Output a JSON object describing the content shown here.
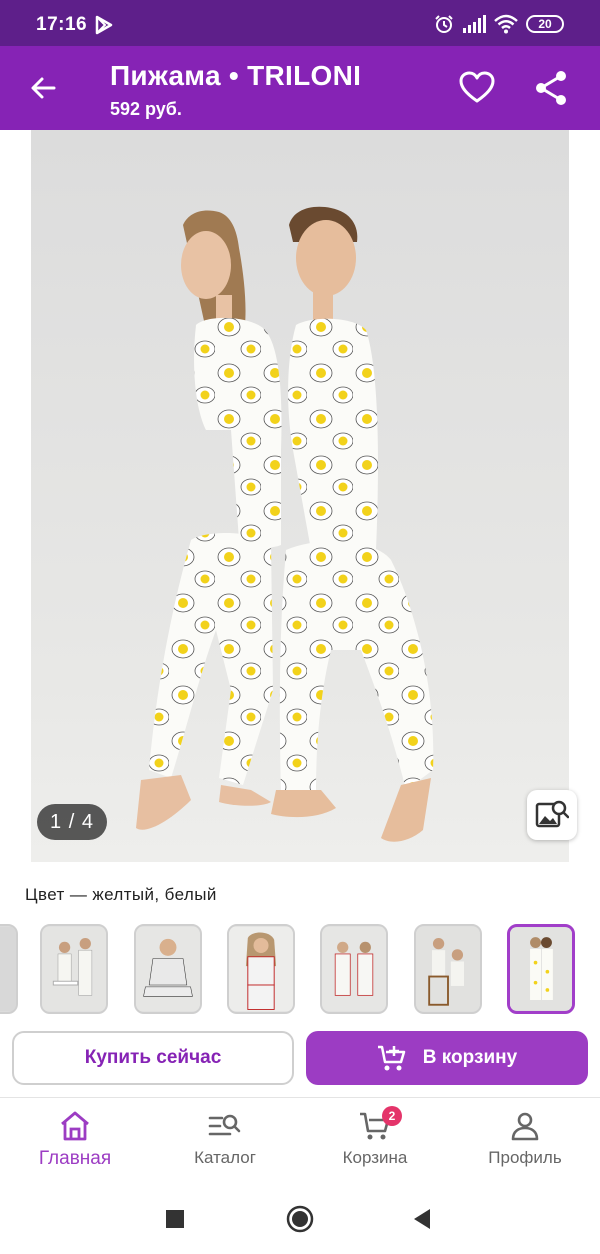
{
  "status_bar": {
    "time": "17:16",
    "battery": "20"
  },
  "header": {
    "title": "Пижама • TRILONI",
    "price": "592 руб."
  },
  "gallery": {
    "counter": "1 / 4"
  },
  "product": {
    "color_text": "Цвет — желтый, белый"
  },
  "actions": {
    "buy_now": "Купить сейчас",
    "add_to_cart": "В корзину"
  },
  "bottom_nav": {
    "items": [
      {
        "label": "Главная",
        "icon": "home-icon",
        "active": true
      },
      {
        "label": "Каталог",
        "icon": "catalog-search-icon"
      },
      {
        "label": "Корзина",
        "icon": "cart-icon",
        "badge": "2"
      },
      {
        "label": "Профиль",
        "icon": "profile-icon"
      }
    ]
  },
  "colors": {
    "status_bar": "#5e1f8a",
    "app_bar": "#8623b5",
    "accent": "#9c3cc3",
    "badge": "#e4346a"
  }
}
